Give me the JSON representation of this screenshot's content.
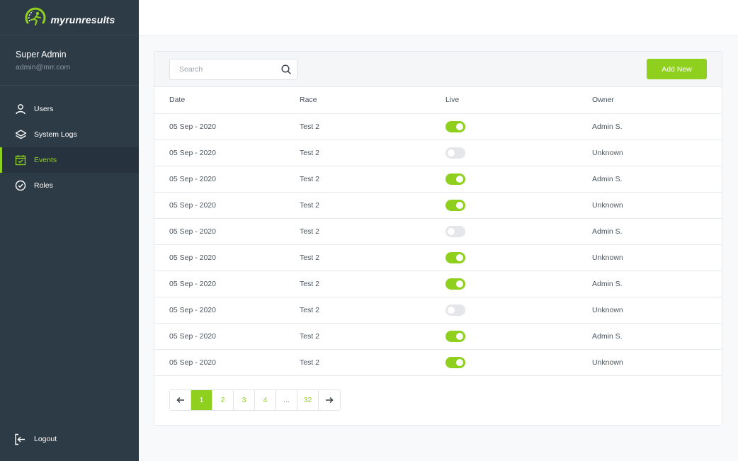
{
  "app": {
    "logo_text": "myrunresults"
  },
  "profile": {
    "name": "Super Admin",
    "email": "admin@mrr.com"
  },
  "nav": [
    {
      "label": "Users",
      "icon": "user-icon"
    },
    {
      "label": "System Logs",
      "icon": "layers-icon"
    },
    {
      "label": "Events",
      "icon": "calendar-icon",
      "active": true
    },
    {
      "label": "Roles",
      "icon": "check-circle-icon"
    }
  ],
  "logout_label": "Logout",
  "search": {
    "placeholder": "Search"
  },
  "add_new_label": "Add New",
  "table": {
    "columns": [
      "Date",
      "Race",
      "Live",
      "Owner"
    ],
    "rows": [
      {
        "date": "05 Sep - 2020",
        "race": "Test 2",
        "live": true,
        "owner": "Admin S."
      },
      {
        "date": "05 Sep - 2020",
        "race": "Test 2",
        "live": false,
        "owner": "Unknown"
      },
      {
        "date": "05 Sep - 2020",
        "race": "Test 2",
        "live": true,
        "owner": "Admin S."
      },
      {
        "date": "05 Sep - 2020",
        "race": "Test 2",
        "live": true,
        "owner": "Unknown"
      },
      {
        "date": "05 Sep - 2020",
        "race": "Test 2",
        "live": false,
        "owner": "Admin S."
      },
      {
        "date": "05 Sep - 2020",
        "race": "Test 2",
        "live": true,
        "owner": "Unknown"
      },
      {
        "date": "05 Sep - 2020",
        "race": "Test 2",
        "live": true,
        "owner": "Admin S."
      },
      {
        "date": "05 Sep - 2020",
        "race": "Test 2",
        "live": false,
        "owner": "Unknown"
      },
      {
        "date": "05 Sep - 2020",
        "race": "Test 2",
        "live": true,
        "owner": "Admin S."
      },
      {
        "date": "05 Sep - 2020",
        "race": "Test 2",
        "live": true,
        "owner": "Unknown"
      }
    ]
  },
  "pagination": {
    "pages": [
      "1",
      "2",
      "3",
      "4",
      "...",
      "32"
    ],
    "current": "1"
  },
  "colors": {
    "accent": "#8fd01e",
    "sidebar": "#2d3b47"
  }
}
